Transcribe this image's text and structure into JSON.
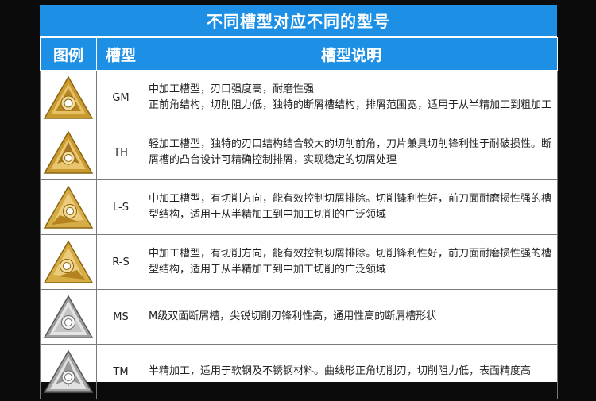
{
  "title": "不同槽型对应不同的型号",
  "headers": {
    "image": "图例",
    "groove": "槽型",
    "description": "槽型说明"
  },
  "rows": [
    {
      "code": "GM",
      "description": "中加工槽型，刃口强度高，耐磨性强\n正前角结构，切削阻力低，独特的断屑槽结构，排屑范围宽，适用于从半精加工到粗加工",
      "insert_icon": "gold-triangle-insert-gm-icon",
      "color": "#d4a53a"
    },
    {
      "code": "TH",
      "description": "轻加工槽型，独特的刃口结构结合较大的切削前角，刀片兼具切削锋利性于耐破损性。断屑槽的凸台设计可精确控制排屑，实现稳定的切屑处理",
      "insert_icon": "gold-triangle-insert-th-icon",
      "color": "#d4a53a"
    },
    {
      "code": "L-S",
      "description": "中加工槽型，有切削方向，能有效控制切屑排除。切削锋利性好，前刀面耐磨损性强的槽型结构，适用于从半精加工到中加工切削的广泛领域",
      "insert_icon": "gold-triangle-insert-ls-icon",
      "color": "#d4a53a"
    },
    {
      "code": "R-S",
      "description": "中加工槽型，有切削方向，能有效控制切屑排除。切削锋利性好，前刀面耐磨损性强的槽型结构，适用于从半精加工到中加工切削的广泛领域",
      "insert_icon": "gold-triangle-insert-rs-icon",
      "color": "#d4a53a"
    },
    {
      "code": "MS",
      "description": "M级双面断屑槽，尖锐切削刃锋利性高，通用性高的断屑槽形状",
      "insert_icon": "silver-triangle-insert-ms-icon",
      "color": "#b8b8b8"
    },
    {
      "code": "TM",
      "description": "半精加工，适用于软钢及不锈钢材料。曲线形正角切削刃，切削阻力低，表面精度高",
      "insert_icon": "silver-triangle-insert-tm-icon",
      "color": "#b8b8b8"
    }
  ]
}
